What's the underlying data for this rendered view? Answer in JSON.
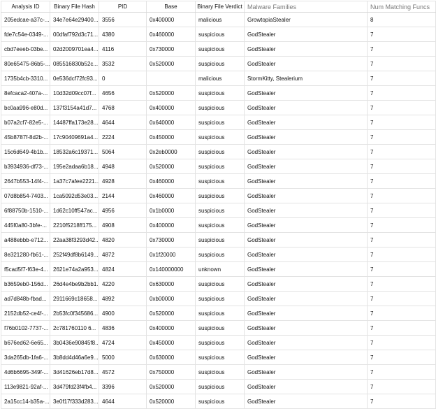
{
  "columns": [
    "Analysis ID",
    "Binary File Hash",
    "PID",
    "Base",
    "Binary File Verdict",
    "Malware Families",
    "Num Matching Funcs"
  ],
  "rows": [
    [
      "205edcae-a37c-...",
      "34e7e64e29400...",
      "3556",
      "0x400000",
      "malicious",
      "GrowtopiaStealer",
      "8"
    ],
    [
      "fde7c54e-0349-...",
      "00dfaf792d3c71...",
      "4380",
      "0x460000",
      "suspicious",
      "GodStealer",
      "7"
    ],
    [
      "cbd7eeeb-03be...",
      "02d2009701ea4...",
      "4116",
      "0x730000",
      "suspicious",
      "GodStealer",
      "7"
    ],
    [
      "80e65475-86b5-...",
      "085516830b52c...",
      "3532",
      "0x520000",
      "suspicious",
      "GodStealer",
      "7"
    ],
    [
      "1735b4cb-3310...",
      "0e536dcf72fc93...",
      "0",
      "",
      "malicious",
      "StormKitty, Stealerium",
      "7"
    ],
    [
      "8efcaca2-407a-...",
      "10d32d09cc07f...",
      "4656",
      "0x520000",
      "suspicious",
      "GodStealer",
      "7"
    ],
    [
      "bc0aa996-e80d...",
      "137f3154a41d7...",
      "4768",
      "0x400000",
      "suspicious",
      "GodStealer",
      "7"
    ],
    [
      "b07a2cf7-82e5-...",
      "14487ffa173e28...",
      "4644",
      "0x640000",
      "suspicious",
      "GodStealer",
      "7"
    ],
    [
      "45b8787f-8d2b-...",
      "17c90409691a4...",
      "2224",
      "0x450000",
      "suspicious",
      "GodStealer",
      "7"
    ],
    [
      "15c6d649-4b1b...",
      "18532a6c19371...",
      "5064",
      "0x2eb0000",
      "suspicious",
      "GodStealer",
      "7"
    ],
    [
      "b3934936-df73-...",
      "195e2adaa6b18...",
      "4948",
      "0x520000",
      "suspicious",
      "GodStealer",
      "7"
    ],
    [
      "2647b553-14f4-...",
      "1a37c7afee2221...",
      "4928",
      "0x460000",
      "suspicious",
      "GodStealer",
      "7"
    ],
    [
      "07d8b854-7403...",
      "1ca5092d53e03...",
      "2144",
      "0x460000",
      "suspicious",
      "GodStealer",
      "7"
    ],
    [
      "6f88750b-1510-...",
      "1d62c10ff547ac...",
      "4956",
      "0x1b0000",
      "suspicious",
      "GodStealer",
      "7"
    ],
    [
      "445f0a80-3bfe-...",
      "2210f5218ff175...",
      "4908",
      "0x400000",
      "suspicious",
      "GodStealer",
      "7"
    ],
    [
      "a488ebbb-e712...",
      "22aa38f3293d42...",
      "4820",
      "0x730000",
      "suspicious",
      "GodStealer",
      "7"
    ],
    [
      "8e321280-fb61-...",
      "252f49df8b6149...",
      "4872",
      "0x1f20000",
      "suspicious",
      "GodStealer",
      "7"
    ],
    [
      "f5cad5f7-f63e-4...",
      "2621e74a2a953...",
      "4824",
      "0x140000000",
      "unknown",
      "GodStealer",
      "7"
    ],
    [
      "b3659eb0-156d...",
      "26d4e4be9b2bb1...",
      "4220",
      "0x630000",
      "suspicious",
      "GodStealer",
      "7"
    ],
    [
      "ad7d848b-fbad...",
      "2911669c18658...",
      "4892",
      "0xb00000",
      "suspicious",
      "GodStealer",
      "7"
    ],
    [
      "2152db52-ce4f-...",
      "2b53fc0f345686...",
      "4900",
      "0x520000",
      "suspicious",
      "GodStealer",
      "7"
    ],
    [
      "f76b0102-7737-...",
      "2c781760110 6...",
      "4836",
      "0x400000",
      "suspicious",
      "GodStealer",
      "7"
    ],
    [
      "b676ed62-6e65...",
      "3b0436e90845f8...",
      "4724",
      "0x450000",
      "suspicious",
      "GodStealer",
      "7"
    ],
    [
      "3da265db-1fa6-...",
      "3b8dd4d46a6e9...",
      "5000",
      "0x630000",
      "suspicious",
      "GodStealer",
      "7"
    ],
    [
      "4d6b6695-349f-...",
      "3d41626eb17d8...",
      "4572",
      "0x750000",
      "suspicious",
      "GodStealer",
      "7"
    ],
    [
      "113e9821-92af-...",
      "3d479fd23f4fb4...",
      "3396",
      "0x520000",
      "suspicious",
      "GodStealer",
      "7"
    ],
    [
      "2a15cc14-b35a-...",
      "3e0f17f333d283...",
      "4644",
      "0x520000",
      "suspicious",
      "GodStealer",
      "7"
    ]
  ]
}
